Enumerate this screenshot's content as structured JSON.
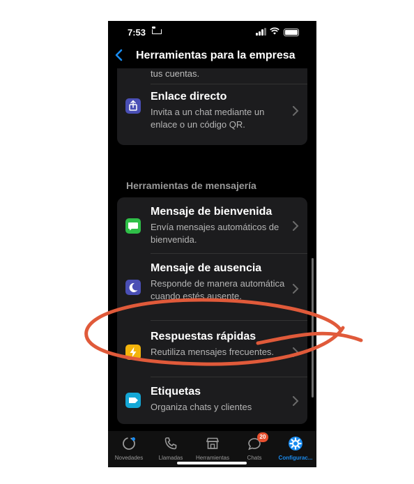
{
  "status_bar": {
    "time": "7:53"
  },
  "header": {
    "title": "Herramientas para la empresa",
    "back_icon": "chevron-left-icon"
  },
  "partial_item": {
    "text": "tus cuentas."
  },
  "items_top": [
    {
      "title": "Enlace directo",
      "description": "Invita a un chat mediante un enlace o un código QR.",
      "icon": "share-icon",
      "icon_color": "#4a4fb5"
    }
  ],
  "section": {
    "title": "Herramientas de mensajería"
  },
  "messaging_items": [
    {
      "title": "Mensaje de bienvenida",
      "description": "Envía mensajes automáticos de bienvenida.",
      "icon": "message-icon",
      "icon_color": "#2fbf48"
    },
    {
      "title": "Mensaje de ausencia",
      "description": "Responde de manera automática cuando estés ausente.",
      "icon": "moon-icon",
      "icon_color": "#4a4fb5"
    },
    {
      "title": "Respuestas rápidas",
      "description": "Reutiliza mensajes frecuentes.",
      "icon": "lightning-icon",
      "icon_color": "#f3b40b"
    },
    {
      "title": "Etiquetas",
      "description": "Organiza chats y clientes",
      "icon": "label-icon",
      "icon_color": "#14a7d6"
    }
  ],
  "tabs": [
    {
      "label": "Novedades",
      "icon": "updates-icon"
    },
    {
      "label": "Llamadas",
      "icon": "phone-icon"
    },
    {
      "label": "Herramientas",
      "icon": "store-icon"
    },
    {
      "label": "Chats",
      "icon": "chats-icon",
      "badge": "20"
    },
    {
      "label": "Configurac...",
      "icon": "settings-icon",
      "active": true
    }
  ],
  "colors": {
    "accent": "#1a8cf0",
    "annotation": "#e05a3a",
    "badge": "#e8502f"
  }
}
